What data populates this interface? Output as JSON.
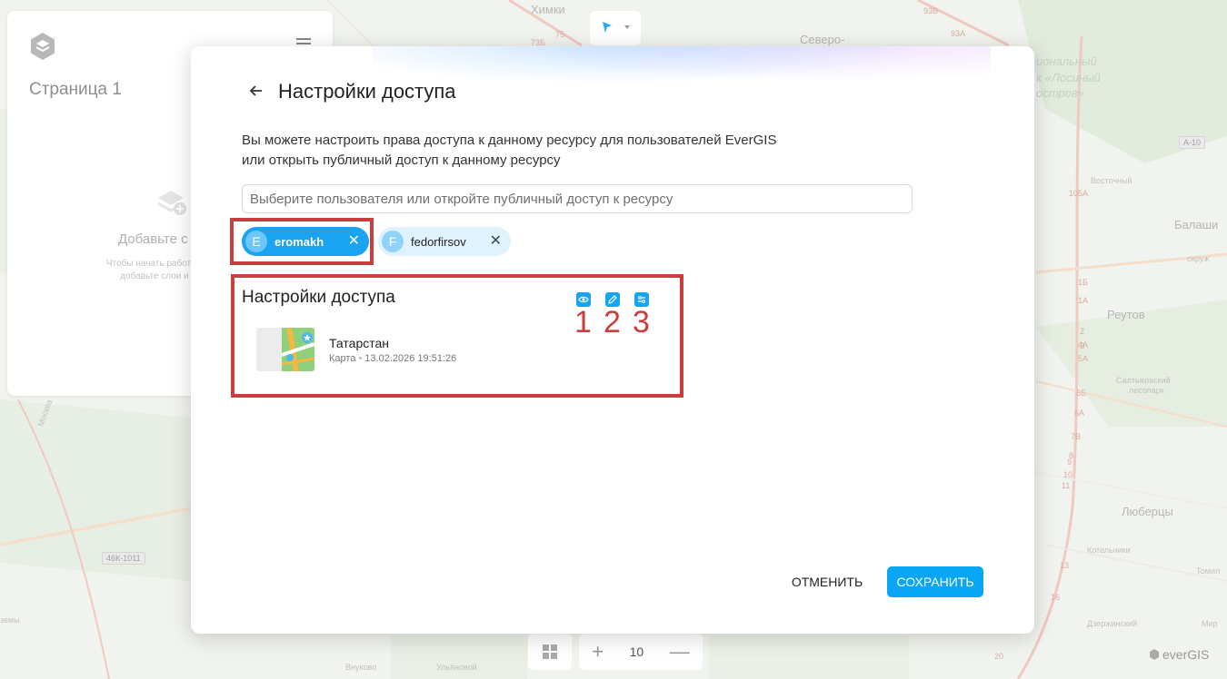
{
  "map": {
    "labels": {
      "khimki": "Химки",
      "severo": "Северо-",
      "park_1": "иональный",
      "park_2": "к «Лосиный",
      "park_3": "остров»",
      "vostochny": "Восточный",
      "balash": "Балаши",
      "reutov": "Реутов",
      "forest_1": "Салтыковский",
      "forest_2": "лесопарк",
      "lyubertsy": "Люберцы",
      "kotelniki": "Котельники",
      "tomil": "Томил",
      "dzerzhinsky": "Дзержинский",
      "mir": "Мир",
      "vnukovo": "Внуково",
      "ulyanovo": "Ульяновой",
      "zemy": "земы",
      "moskva": "Москва",
      "mkad": "окруж"
    },
    "road_numbers": [
      "93В",
      "93А",
      "73Б",
      "75",
      "105А",
      "1Б",
      "1А",
      "2",
      "3",
      "4А",
      "5А",
      "5Б",
      "6А",
      "7В",
      "8",
      "9",
      "10",
      "11",
      "13",
      "16",
      "20"
    ],
    "shields": {
      "a10": "А-10",
      "route_46k": "46К-1011"
    }
  },
  "left_panel": {
    "page_title": "Страница 1",
    "empty_title": "Добавьте с",
    "empty_hint_1": "Чтобы начать работу с",
    "empty_hint_2": "добавьте слои и"
  },
  "zoom": {
    "level": "10",
    "plus": "+",
    "minus": "—"
  },
  "brand": "everGIS",
  "modal": {
    "title": "Настройки доступа",
    "description_line1": "Вы можете настроить права доступа к данному ресурсу для пользователей EverGIS",
    "description_line2": "или открыть публичный доступ к данному ресурсу",
    "search_placeholder": "Выберите пользователя или откройте публичный доступ к ресурсу",
    "users": [
      {
        "initial": "E",
        "name": "eromakh",
        "active": true
      },
      {
        "initial": "F",
        "name": "fedorfirsov",
        "active": false
      }
    ],
    "permissions_title": "Настройки доступа",
    "permission_numbers": [
      "1",
      "2",
      "3"
    ],
    "resource": {
      "name": "Татарстан",
      "type": "Карта",
      "date": "13.02.2026 19:51:26"
    },
    "cancel_label": "ОТМЕНИТЬ",
    "save_label": "СОХРАНИТЬ"
  },
  "colors": {
    "accent": "#1aa3f0",
    "save_button": "#08a6f5",
    "annotation_red": "#cc3d3d",
    "chip_inactive_bg": "#dff2fd"
  },
  "icons": {
    "back": "arrow-left-icon",
    "view": "eye-icon",
    "edit": "pencil-icon",
    "configure": "sliders-icon",
    "close": "close-icon"
  }
}
